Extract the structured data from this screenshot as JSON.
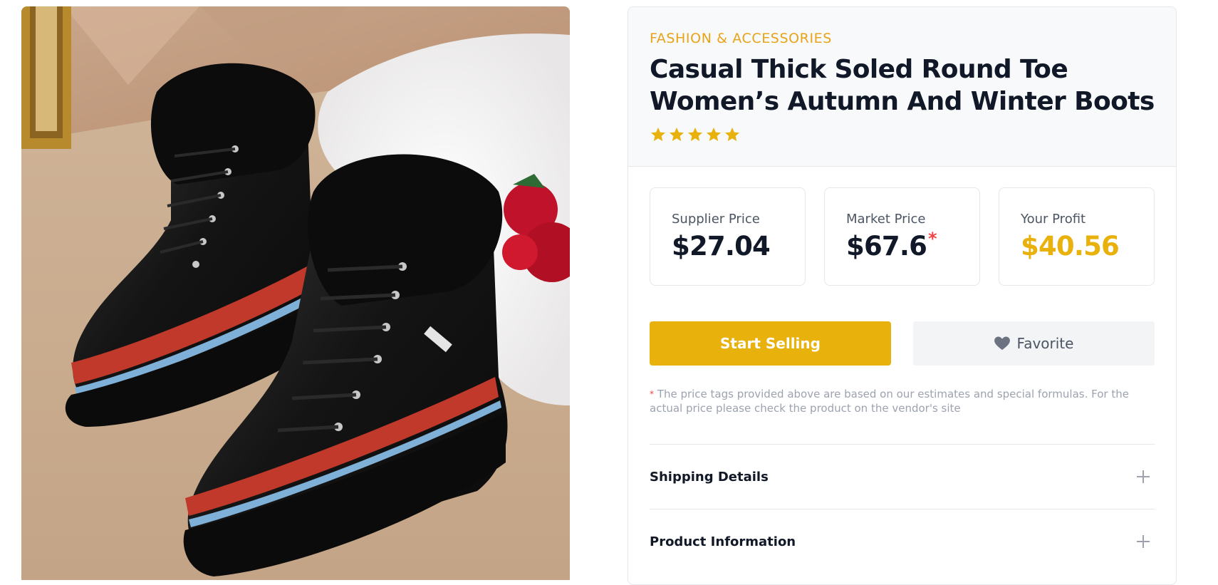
{
  "product": {
    "category": "FASHION & ACCESSORIES",
    "title": "Casual Thick Soled Round Toe Women’s Autumn And Winter Boots",
    "rating_stars": 5,
    "image_icon": "product-photo-black-fur-boots"
  },
  "prices": {
    "supplier": {
      "label": "Supplier Price",
      "value": "$27.04"
    },
    "market": {
      "label": "Market Price",
      "value": "$67.6",
      "asterisk": "*"
    },
    "profit": {
      "label": "Your Profit",
      "value": "$40.56"
    }
  },
  "actions": {
    "start_selling_label": "Start Selling",
    "favorite_label": "Favorite"
  },
  "disclaimer": {
    "asterisk": "*",
    "text": "The price tags provided above are based on our estimates and special formulas. For the actual price please check the product on the vendor's site"
  },
  "accordion": {
    "items": [
      {
        "label": "Shipping Details"
      },
      {
        "label": "Product Information"
      }
    ]
  },
  "colors": {
    "accent": "#e8b10c",
    "category": "#e8a317",
    "asterisk": "#ef4444",
    "star": "#e8b10c"
  }
}
